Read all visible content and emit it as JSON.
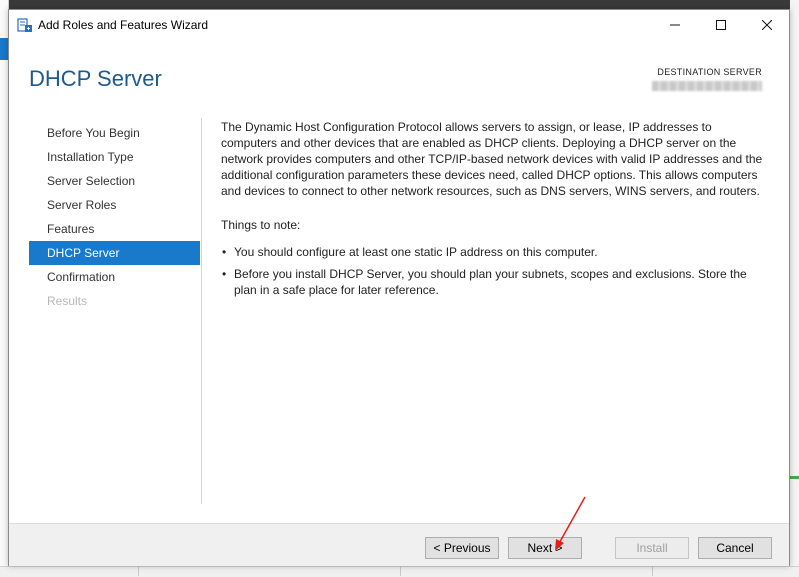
{
  "window": {
    "title": "Add Roles and Features Wizard",
    "minimize_glyph": "—",
    "maximize_glyph": "☐",
    "close_glyph": "✕"
  },
  "header": {
    "title": "DHCP Server",
    "destination_label": "DESTINATION SERVER"
  },
  "steps": [
    {
      "label": "Before You Begin",
      "state": "normal"
    },
    {
      "label": "Installation Type",
      "state": "normal"
    },
    {
      "label": "Server Selection",
      "state": "normal"
    },
    {
      "label": "Server Roles",
      "state": "normal"
    },
    {
      "label": "Features",
      "state": "normal"
    },
    {
      "label": "DHCP Server",
      "state": "active"
    },
    {
      "label": "Confirmation",
      "state": "normal"
    },
    {
      "label": "Results",
      "state": "disabled"
    }
  ],
  "content": {
    "intro": "The Dynamic Host Configuration Protocol allows servers to assign, or lease, IP addresses to computers and other devices that are enabled as DHCP clients. Deploying a DHCP server on the network provides computers and other TCP/IP-based network devices with valid IP addresses and the additional configuration parameters these devices need, called DHCP options. This allows computers and devices to connect to other network resources, such as DNS servers, WINS servers, and routers.",
    "notes_heading": "Things to note:",
    "notes": [
      "You should configure at least one static IP address on this computer.",
      "Before you install DHCP Server, you should plan your subnets, scopes and exclusions. Store the plan in a safe place for later reference."
    ]
  },
  "footer": {
    "previous_label": "< Previous",
    "next_label": "Next >",
    "install_label": "Install",
    "cancel_label": "Cancel"
  },
  "colors": {
    "accent": "#1979ca",
    "title_blue": "#1d5a8f",
    "arrow": "#e0201b"
  }
}
